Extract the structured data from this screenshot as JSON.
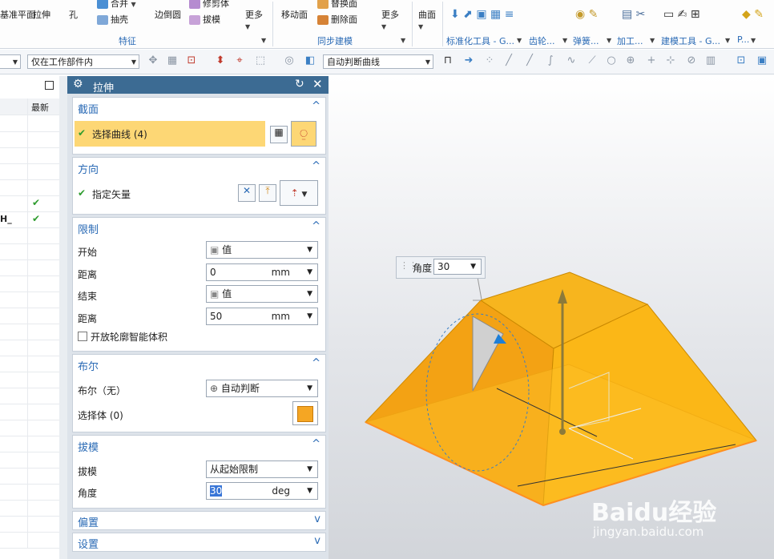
{
  "ribbon": {
    "items": {
      "plane_label": "基准平面",
      "extrude_label": "拉伸",
      "hole_label": "孔",
      "unite_label": "合并",
      "shell_label": "抽壳",
      "edge_blend_label": "边倒圆",
      "trim_label": "修剪体",
      "draft_label": "拔模",
      "more1_label": "更多",
      "move_face_label": "移动面",
      "replace_face_label": "替换面",
      "delete_face_label": "删除面",
      "more2_label": "更多",
      "surface_label": "曲面"
    },
    "groups": {
      "feature": "特征",
      "sync_modeling": "同步建模",
      "std_tools": "标准化工具 - G...",
      "gear": "齿轮...",
      "spring": "弹簧...",
      "machining": "加工...",
      "modeling_tools": "建模工具 - G...",
      "more": "P..."
    }
  },
  "toolbar2": {
    "filter_value": "仅在工作部件内",
    "curve_rule_value": "自动判断曲线"
  },
  "nav": {
    "header_latest": "最新",
    "row_text": "H_"
  },
  "dialog": {
    "title": "拉伸",
    "section": {
      "title": "截面",
      "select_curve": "选择曲线 (4)"
    },
    "direction": {
      "title": "方向",
      "specify_vector": "指定矢量"
    },
    "limits": {
      "title": "限制",
      "start_label": "开始",
      "start_value": "值",
      "distance1_label": "距离",
      "distance1_value": "0",
      "unit_mm": "mm",
      "end_label": "结束",
      "end_value": "值",
      "distance2_label": "距离",
      "distance2_value": "50",
      "open_profile_label": "开放轮廓智能体积"
    },
    "boolean": {
      "title": "布尔",
      "label": "布尔（无）",
      "value": "自动判断",
      "select_body_label": "选择体 (0)"
    },
    "draft": {
      "title": "拔模",
      "draft_label": "拔模",
      "draft_value": "从起始限制",
      "angle_label": "角度",
      "angle_value": "30",
      "unit_deg": "deg"
    },
    "offset": {
      "title": "偏置"
    },
    "settings": {
      "title": "设置"
    }
  },
  "viewport": {
    "angle_label": "角度",
    "angle_value": "30",
    "watermark": "Baidu经验",
    "watermark_url": "jingyan.baidu.com"
  },
  "colors": {
    "title_bar": "#3c6b93",
    "section_title": "#2a6ab5",
    "highlight": "#fdd775",
    "solid_orange": "#f6a915",
    "check_green": "#2e9c2e"
  }
}
